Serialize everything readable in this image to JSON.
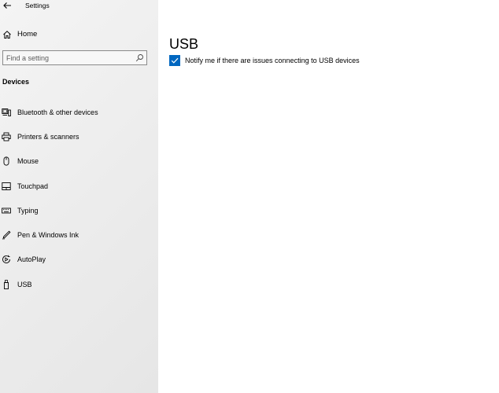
{
  "window": {
    "title": "Settings"
  },
  "sidebar": {
    "home_label": "Home",
    "search_placeholder": "Find a setting",
    "section_heading": "Devices",
    "items": [
      {
        "label": "Bluetooth & other devices",
        "icon": "bluetooth-devices-icon"
      },
      {
        "label": "Printers & scanners",
        "icon": "printer-icon"
      },
      {
        "label": "Mouse",
        "icon": "mouse-icon"
      },
      {
        "label": "Touchpad",
        "icon": "touchpad-icon"
      },
      {
        "label": "Typing",
        "icon": "keyboard-icon"
      },
      {
        "label": "Pen & Windows Ink",
        "icon": "pen-icon"
      },
      {
        "label": "AutoPlay",
        "icon": "autoplay-icon"
      },
      {
        "label": "USB",
        "icon": "usb-icon"
      }
    ]
  },
  "main": {
    "title": "USB",
    "checkbox": {
      "label": "Notify me if there are issues connecting to USB devices",
      "checked": true
    }
  },
  "colors": {
    "accent": "#0067c0",
    "sidebar_bg": "#ececec",
    "content_bg": "#ffffff"
  }
}
